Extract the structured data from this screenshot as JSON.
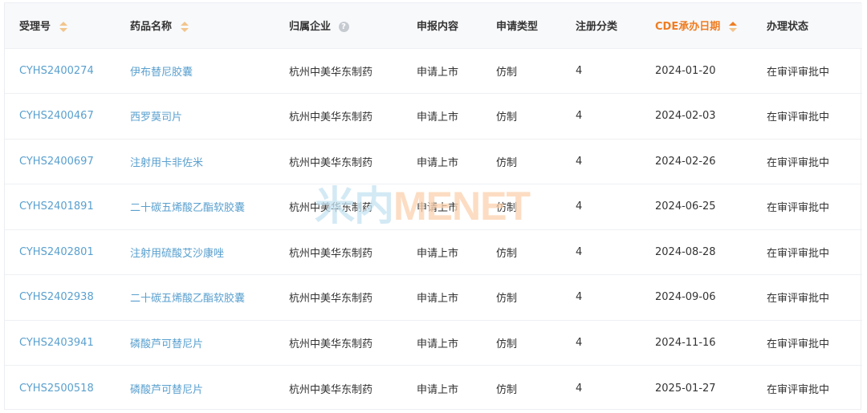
{
  "table": {
    "headers": {
      "accept_no": "受理号",
      "drug_name": "药品名称",
      "company": "归属企业",
      "content": "申报内容",
      "app_type": "申请类型",
      "reg_class": "注册分类",
      "cde_date": "CDE承办日期",
      "status": "办理状态"
    },
    "help_glyph": "?",
    "rows": [
      {
        "accept_no": "CYHS2400274",
        "drug_name": "伊布替尼胶囊",
        "company": "杭州中美华东制药",
        "content": "申请上市",
        "app_type": "仿制",
        "reg_class": "4",
        "cde_date": "2024-01-20",
        "status": "在审评审批中"
      },
      {
        "accept_no": "CYHS2400467",
        "drug_name": "西罗莫司片",
        "company": "杭州中美华东制药",
        "content": "申请上市",
        "app_type": "仿制",
        "reg_class": "4",
        "cde_date": "2024-02-03",
        "status": "在审评审批中"
      },
      {
        "accept_no": "CYHS2400697",
        "drug_name": "注射用卡非佐米",
        "company": "杭州中美华东制药",
        "content": "申请上市",
        "app_type": "仿制",
        "reg_class": "4",
        "cde_date": "2024-02-26",
        "status": "在审评审批中"
      },
      {
        "accept_no": "CYHS2401891",
        "drug_name": "二十碳五烯酸乙酯软胶囊",
        "company": "杭州中美华东制药",
        "content": "申请上市",
        "app_type": "仿制",
        "reg_class": "4",
        "cde_date": "2024-06-25",
        "status": "在审评审批中"
      },
      {
        "accept_no": "CYHS2402801",
        "drug_name": "注射用硫酸艾沙康唑",
        "company": "杭州中美华东制药",
        "content": "申请上市",
        "app_type": "仿制",
        "reg_class": "4",
        "cde_date": "2024-08-28",
        "status": "在审评审批中"
      },
      {
        "accept_no": "CYHS2402938",
        "drug_name": "二十碳五烯酸乙酯软胶囊",
        "company": "杭州中美华东制药",
        "content": "申请上市",
        "app_type": "仿制",
        "reg_class": "4",
        "cde_date": "2024-09-06",
        "status": "在审评审批中"
      },
      {
        "accept_no": "CYHS2403941",
        "drug_name": "磷酸芦可替尼片",
        "company": "杭州中美华东制药",
        "content": "申请上市",
        "app_type": "仿制",
        "reg_class": "4",
        "cde_date": "2024-11-16",
        "status": "在审评审批中"
      },
      {
        "accept_no": "CYHS2500518",
        "drug_name": "磷酸芦可替尼片",
        "company": "杭州中美华东制药",
        "content": "申请上市",
        "app_type": "仿制",
        "reg_class": "4",
        "cde_date": "2025-01-27",
        "status": "在审评审批中"
      }
    ]
  },
  "watermark": {
    "cn": "米内",
    "en": "MENET"
  },
  "colors": {
    "link": "#5aa0cf",
    "accent": "#ef7d22",
    "text": "#333333",
    "header_bg": "#f8f9fb"
  },
  "icons": {
    "sort": "sort-arrows-icon",
    "help": "question-circle-icon"
  }
}
